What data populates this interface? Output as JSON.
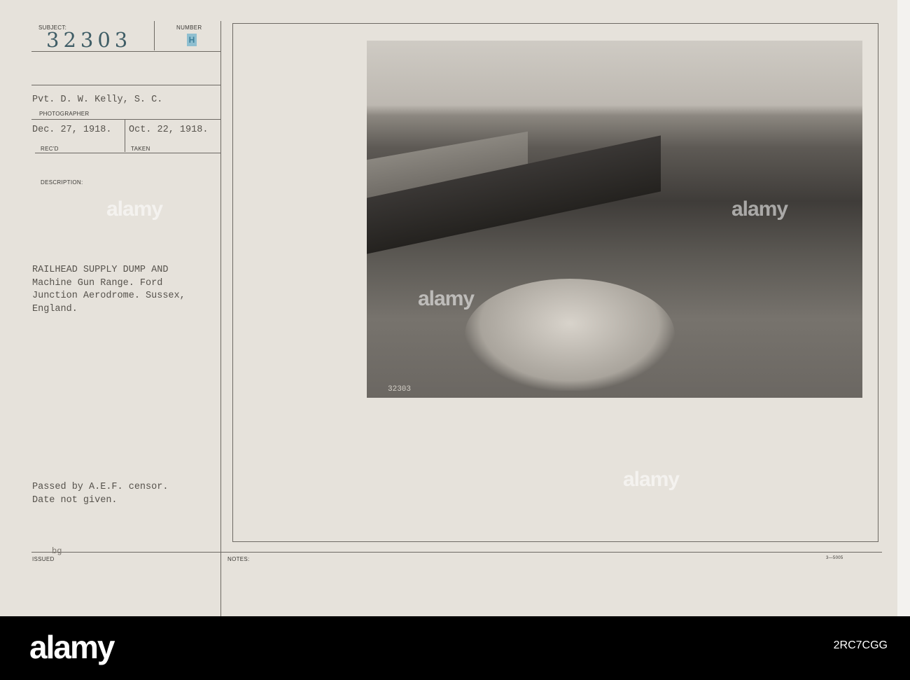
{
  "card": {
    "subject_label": "SUBJECT:",
    "subject_number": "32303",
    "number_label": "NUMBER",
    "number_stamp": "H",
    "photographer": "Pvt. D. W. Kelly, S. C.",
    "photographer_label": "PHOTOGRAPHER",
    "received": "Dec. 27, 1918.",
    "received_label": "REC'D",
    "taken": "Oct. 22, 1918.",
    "taken_label": "TAKEN",
    "description_label": "DESCRIPTION:",
    "description_lines": [
      "RAILHEAD SUPPLY DUMP AND",
      "Machine Gun Range. Ford",
      "Junction Aerodrome. Sussex,",
      "England."
    ],
    "censor_lines": [
      "Passed by A.E.F. censor.",
      "Date not given."
    ],
    "issued_label": "ISSUED",
    "issued_value": "bg",
    "notes_label": "NOTES:",
    "form_code": "3—5005",
    "photo_number": "32303"
  },
  "watermark": "alamy",
  "footer": {
    "logo": "alamy",
    "image_code": "2RC7CGG"
  }
}
